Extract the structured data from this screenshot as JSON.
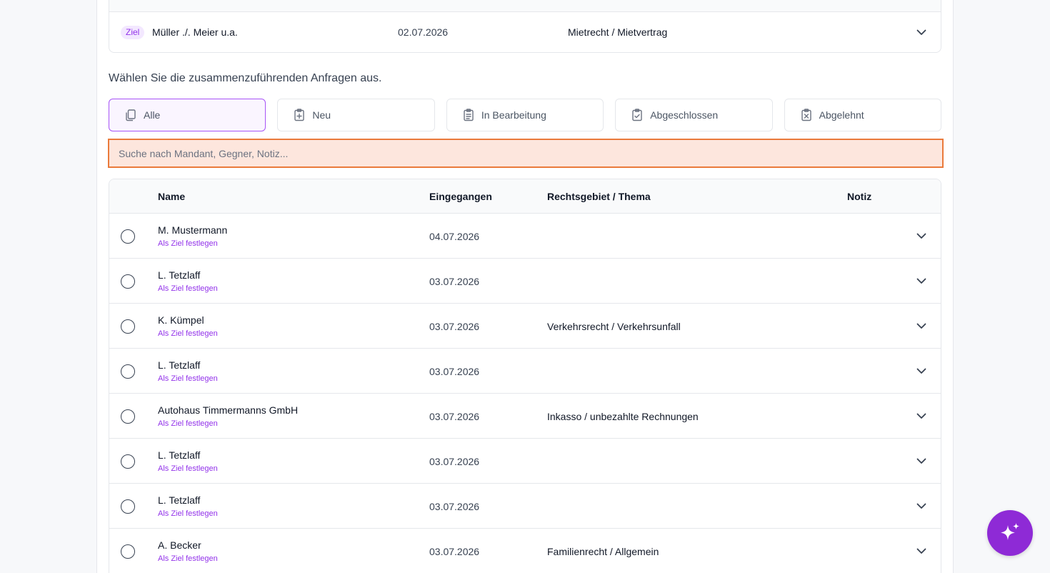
{
  "target": {
    "badge": "Ziel",
    "name": "Müller ./. Meier u.a.",
    "date": "02.07.2026",
    "area": "Mietrecht / Mietvertrag"
  },
  "instruction": "Wählen Sie die zusammenzuführenden Anfragen aus.",
  "filters": [
    {
      "label": "Alle",
      "icon": "copy-icon"
    },
    {
      "label": "Neu",
      "icon": "clipboard-plus-icon"
    },
    {
      "label": "In Bearbeitung",
      "icon": "clipboard-list-icon"
    },
    {
      "label": "Abgeschlossen",
      "icon": "clipboard-check-icon"
    },
    {
      "label": "Abgelehnt",
      "icon": "clipboard-x-icon"
    }
  ],
  "search": {
    "placeholder": "Suche nach Mandant, Gegner, Notiz..."
  },
  "table": {
    "headers": {
      "name": "Name",
      "date": "Eingegangen",
      "area": "Rechtsgebiet / Thema",
      "note": "Notiz"
    },
    "link_label": "Als Ziel festlegen",
    "rows": [
      {
        "name": "M. Mustermann",
        "date": "04.07.2026",
        "area": ""
      },
      {
        "name": "L. Tetzlaff",
        "date": "03.07.2026",
        "area": ""
      },
      {
        "name": "K. Kümpel",
        "date": "03.07.2026",
        "area": "Verkehrsrecht / Verkehrsunfall"
      },
      {
        "name": "L. Tetzlaff",
        "date": "03.07.2026",
        "area": ""
      },
      {
        "name": "Autohaus Timmermanns GmbH",
        "date": "03.07.2026",
        "area": "Inkasso / unbezahlte Rechnungen"
      },
      {
        "name": "L. Tetzlaff",
        "date": "03.07.2026",
        "area": ""
      },
      {
        "name": "L. Tetzlaff",
        "date": "03.07.2026",
        "area": ""
      },
      {
        "name": "A. Becker",
        "date": "03.07.2026",
        "area": "Familienrecht / Allgemein"
      }
    ]
  },
  "colors": {
    "accent": "#9333ea",
    "fab": "#8e2ad6",
    "search_bg": "#fde6dd",
    "search_border": "#ea7a3b"
  }
}
